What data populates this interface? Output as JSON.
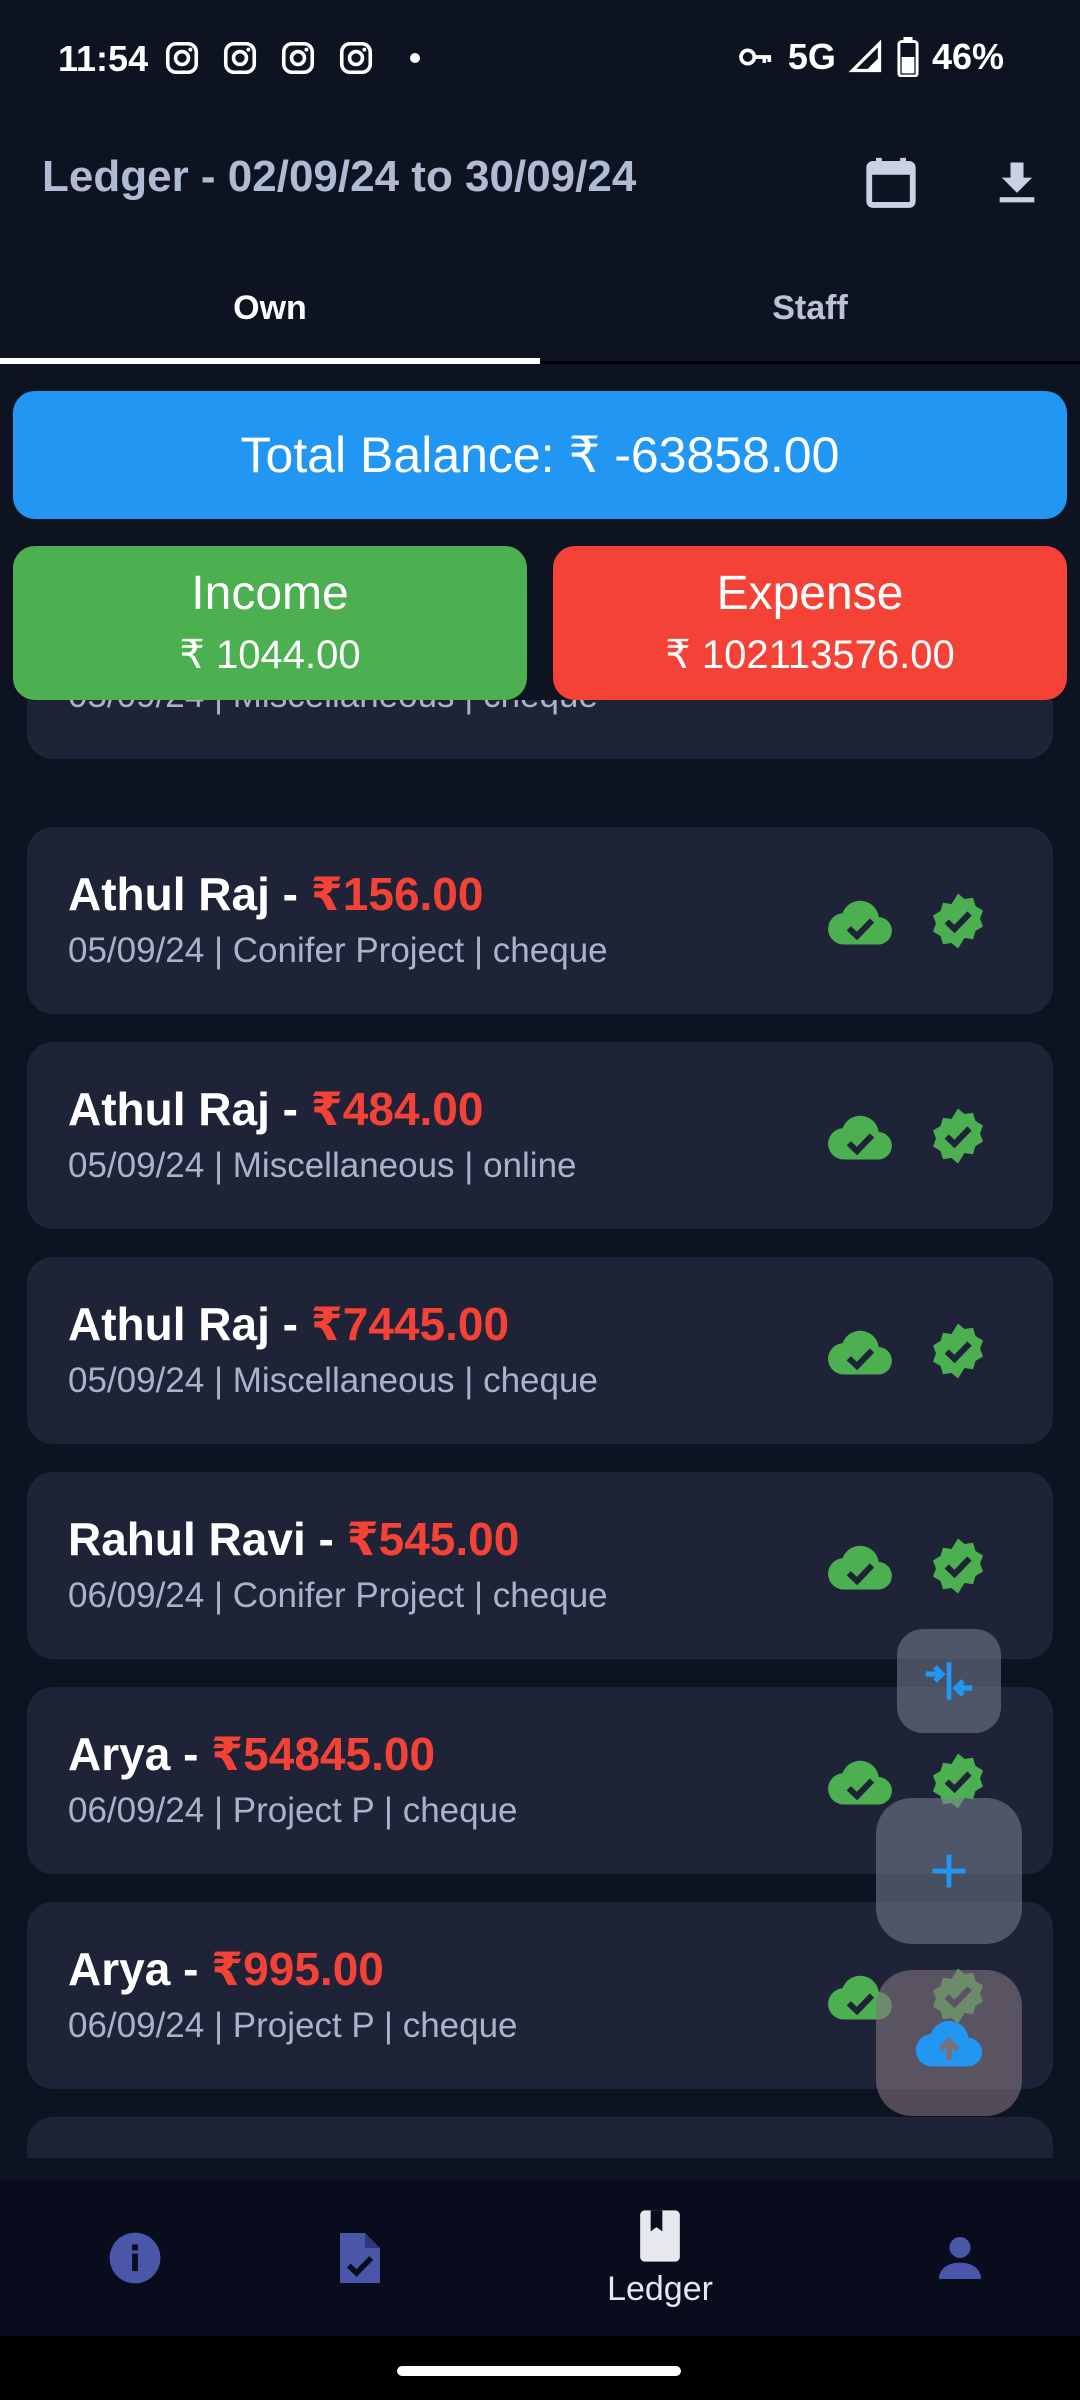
{
  "status_bar": {
    "time": "11:54",
    "network": "5G",
    "battery": "46%",
    "app_icons": [
      "instagram-icon",
      "instagram-icon",
      "instagram-icon",
      "instagram-icon"
    ]
  },
  "header": {
    "title": "Ledger - 02/09/24 to 30/09/24",
    "calendar_icon": "calendar-icon",
    "download_icon": "download-icon"
  },
  "tabs": [
    {
      "label": "Own",
      "selected": true
    },
    {
      "label": "Staff",
      "selected": false
    }
  ],
  "summary": {
    "total_balance": "Total Balance: ₹ -63858.00",
    "income_label": "Income",
    "income_value": "₹ 1044.00",
    "expense_label": "Expense",
    "expense_value": "₹ 102113576.00"
  },
  "entries": [
    {
      "name": "",
      "amount": "",
      "meta": "05/09/24 | Miscellaneous | cheque"
    },
    {
      "name": "Athul Raj - ",
      "amount": "₹156.00",
      "meta": "05/09/24 | Conifer Project | cheque"
    },
    {
      "name": "Athul Raj - ",
      "amount": "₹484.00",
      "meta": "05/09/24 | Miscellaneous | online"
    },
    {
      "name": "Athul Raj - ",
      "amount": "₹7445.00",
      "meta": "05/09/24 | Miscellaneous | cheque"
    },
    {
      "name": "Rahul Ravi - ",
      "amount": "₹545.00",
      "meta": "06/09/24 | Conifer Project | cheque"
    },
    {
      "name": "Arya - ",
      "amount": "₹54845.00",
      "meta": "06/09/24 | Project P | cheque"
    },
    {
      "name": "Arya - ",
      "amount": "₹995.00",
      "meta": "06/09/24 | Project P | cheque"
    }
  ],
  "bottom_nav": {
    "items": [
      {
        "icon": "info-icon",
        "label": ""
      },
      {
        "icon": "task-icon",
        "label": ""
      },
      {
        "icon": "ledger-icon",
        "label": "Ledger"
      },
      {
        "icon": "profile-icon",
        "label": ""
      }
    ]
  },
  "colors": {
    "background": "#0e1322",
    "card": "#1f2337",
    "total": "#2196f3",
    "income": "#4caf50",
    "expense": "#f44336",
    "amount_text": "#f44336",
    "status_icons": "#4caf50",
    "fab_icon": "#2196f3"
  }
}
